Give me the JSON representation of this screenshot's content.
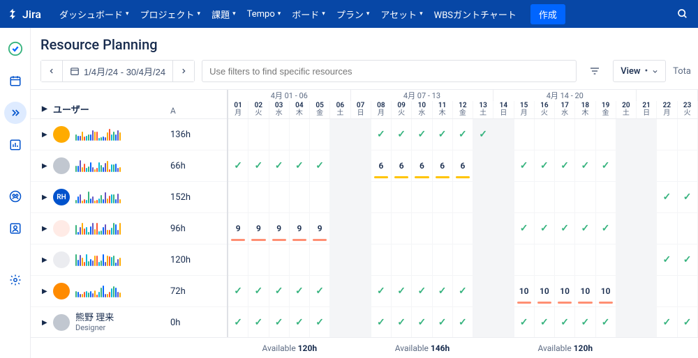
{
  "nav": {
    "logo": "Jira",
    "items": [
      "ダッシュボード",
      "プロジェクト",
      "課題",
      "Tempo",
      "ボード",
      "プラン",
      "アセット",
      "WBSガントチャート"
    ],
    "create": "作成"
  },
  "page": {
    "title": "Resource Planning"
  },
  "toolbar": {
    "date_range": "1/4月/24 - 30/4月/24",
    "filter_placeholder": "Use filters to find specific resources",
    "view_label": "View",
    "total_label": "Tota"
  },
  "grid_headers": {
    "user": "ユーザー",
    "a": "A"
  },
  "weeks": [
    {
      "label": "4月 01 - 06",
      "days": 6
    },
    {
      "label": "4月 07 - 13",
      "days": 7
    },
    {
      "label": "4月 14 - 20",
      "days": 7
    },
    {
      "label": "",
      "days": 3
    }
  ],
  "days": [
    {
      "n": "01",
      "d": "月",
      "w": false
    },
    {
      "n": "02",
      "d": "火",
      "w": false
    },
    {
      "n": "03",
      "d": "水",
      "w": false
    },
    {
      "n": "04",
      "d": "木",
      "w": false
    },
    {
      "n": "05",
      "d": "金",
      "w": false
    },
    {
      "n": "06",
      "d": "土",
      "w": true
    },
    {
      "n": "07",
      "d": "日",
      "w": true
    },
    {
      "n": "08",
      "d": "月",
      "w": false
    },
    {
      "n": "09",
      "d": "火",
      "w": false
    },
    {
      "n": "10",
      "d": "水",
      "w": false
    },
    {
      "n": "11",
      "d": "木",
      "w": false
    },
    {
      "n": "12",
      "d": "金",
      "w": false
    },
    {
      "n": "13",
      "d": "土",
      "w": true
    },
    {
      "n": "14",
      "d": "日",
      "w": true
    },
    {
      "n": "15",
      "d": "月",
      "w": false
    },
    {
      "n": "16",
      "d": "火",
      "w": false
    },
    {
      "n": "17",
      "d": "水",
      "w": false
    },
    {
      "n": "18",
      "d": "木",
      "w": false
    },
    {
      "n": "19",
      "d": "金",
      "w": false
    },
    {
      "n": "20",
      "d": "土",
      "w": true
    },
    {
      "n": "21",
      "d": "日",
      "w": true
    },
    {
      "n": "22",
      "d": "月",
      "w": false
    },
    {
      "n": "23",
      "d": "火",
      "w": false
    }
  ],
  "users": [
    {
      "avatar_bg": "#ffab00",
      "avatar_txt": "",
      "name": "",
      "a": "136h",
      "cells": [
        "",
        "",
        "",
        "",
        "",
        "",
        "",
        "c",
        "c",
        "c",
        "c",
        "c",
        "c",
        "",
        "",
        "",
        "",
        "",
        "",
        "",
        "",
        "",
        ""
      ]
    },
    {
      "avatar_bg": "#c1c7d0",
      "avatar_txt": "",
      "name": "",
      "a": "66h",
      "cells": [
        "c",
        "c",
        "c",
        "c",
        "c",
        "",
        "",
        "6y",
        "6y",
        "6y",
        "6y",
        "6y",
        "",
        "",
        "c",
        "c",
        "c",
        "c",
        "c",
        "",
        "",
        "",
        ""
      ]
    },
    {
      "avatar_bg": "#0052cc",
      "avatar_txt": "RH",
      "name": "",
      "a": "152h",
      "cells": [
        "",
        "",
        "",
        "",
        "",
        "",
        "",
        "",
        "",
        "",
        "",
        "",
        "",
        "",
        "",
        "",
        "",
        "",
        "",
        "",
        "",
        "c",
        "c"
      ]
    },
    {
      "avatar_bg": "#ffebe6",
      "avatar_txt": "",
      "name": "",
      "a": "96h",
      "cells": [
        "9r",
        "9r",
        "9r",
        "9r",
        "9r",
        "",
        "",
        "",
        "",
        "",
        "",
        "",
        "",
        "",
        "c",
        "c",
        "c",
        "c",
        "c",
        "",
        "",
        "",
        ""
      ]
    },
    {
      "avatar_bg": "#ebecf0",
      "avatar_txt": "",
      "name": "",
      "a": "120h",
      "cells": [
        "",
        "",
        "",
        "",
        "",
        "",
        "",
        "",
        "",
        "",
        "",
        "",
        "",
        "",
        "",
        "",
        "",
        "",
        "",
        "",
        "",
        "c",
        "c"
      ]
    },
    {
      "avatar_bg": "#ff8b00",
      "avatar_txt": "",
      "name": "",
      "a": "72h",
      "cells": [
        "c",
        "c",
        "c",
        "c",
        "c",
        "",
        "",
        "c",
        "c",
        "c",
        "c",
        "c",
        "",
        "",
        "10r",
        "10r",
        "10r",
        "10r",
        "10r",
        "",
        "",
        "",
        ""
      ]
    },
    {
      "avatar_bg": "#c1c7d0",
      "avatar_txt": "",
      "name": "熊野 理来",
      "sub": "Designer",
      "a": "0h",
      "cells": [
        "c",
        "c",
        "c",
        "c",
        "c",
        "",
        "",
        "c",
        "c",
        "c",
        "c",
        "c",
        "",
        "",
        "c",
        "c",
        "c",
        "c",
        "c",
        "",
        "",
        "c",
        "c"
      ]
    }
  ],
  "footer": {
    "available_label": "Available",
    "values": [
      "120h",
      "146h",
      "120h"
    ]
  },
  "colors": {
    "check": "#36b37e",
    "yellow": "#ffc400",
    "red": "#ff8f73"
  }
}
